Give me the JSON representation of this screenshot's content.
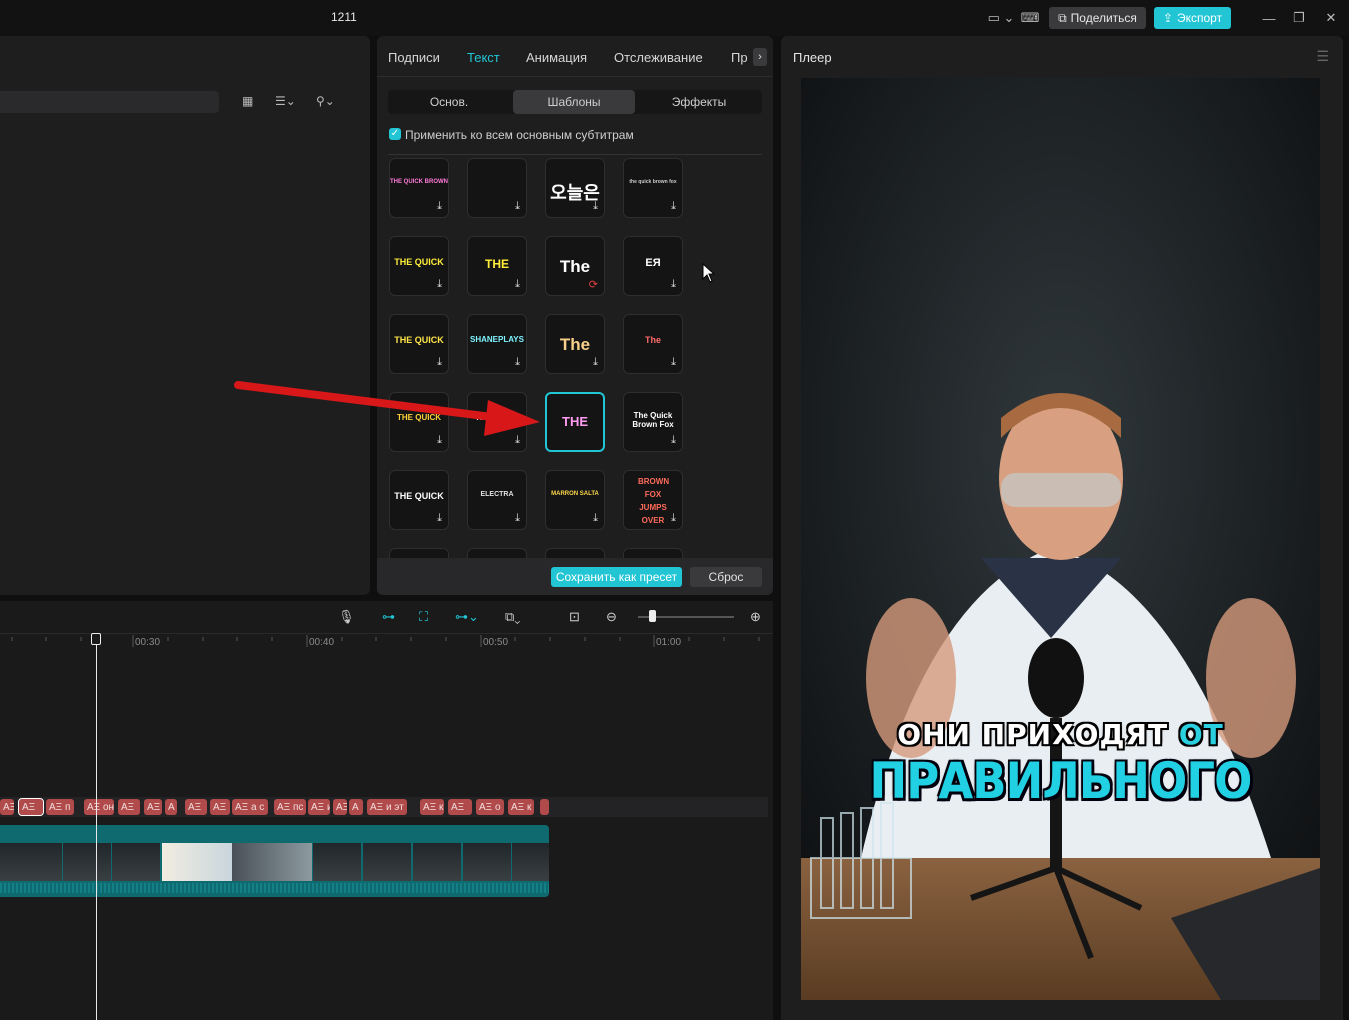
{
  "window": {
    "title": "1211",
    "share_label": "Поделиться",
    "export_label": "Экспорт"
  },
  "panel_tabs": [
    "Подписи",
    "Текст",
    "Анимация",
    "Отслеживание",
    "Пр"
  ],
  "subtabs": [
    "Основ.",
    "Шаблоны",
    "Эффекты"
  ],
  "apply_all_label": "Применить ко всем основным субтитрам",
  "apply_all_checked": true,
  "templates": [
    "THE QUICK BROWN FOX",
    "",
    "오늘은",
    "the quick brown fox",
    "THE QUICK",
    "THE",
    "The",
    "ЕЯ",
    "THE QUICK",
    "SHANEPLAYS",
    "The",
    "The",
    "THE QUICK",
    "THE QUICK",
    "THE",
    "The Quick Brown Fox",
    "THE QUICK",
    "ELECTRA",
    "MARRON SALTA",
    "BROWN FOX JUMPS OVER"
  ],
  "footer": {
    "save_preset": "Сохранить как пресет",
    "reset": "Сброс"
  },
  "player": {
    "title": "Плеер",
    "caption_line1_a": "ОНИ ПРИХОДЯТ ",
    "caption_line1_b": "ОТ",
    "caption_line2": "ПРАВИЛЬНОГО"
  },
  "ruler": [
    "00:30",
    "00:40",
    "00:50",
    "01:00"
  ],
  "subtitle_clips": [
    "AΞ",
    "AΞ",
    "AΞ п",
    "AΞ он",
    "AΞ",
    "AΞ",
    "A",
    "AΞ",
    "AΞ",
    "AΞ а с",
    "AΞ пс",
    "AΞ и",
    "AΞ",
    "A",
    "AΞ и эт",
    "AΞ к",
    "AΞ ",
    "AΞ о",
    "AΞ к"
  ],
  "colors": {
    "accent": "#21c5d4",
    "subtitle_clip": "#b14a4a",
    "video_track": "#0f6a70",
    "annotation_arrow": "#d81818"
  }
}
